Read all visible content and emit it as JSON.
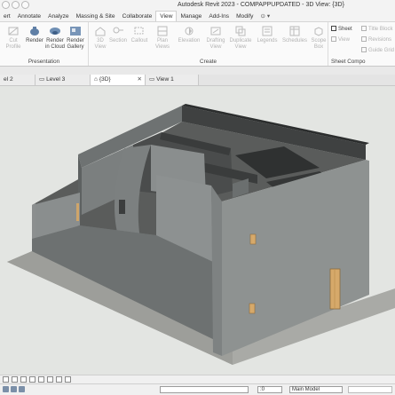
{
  "window": {
    "title": "Autodesk Revit 2023 - COMPAPPUPDATED - 3D View: {3D}"
  },
  "ribbon_tabs": [
    "ert",
    "Annotate",
    "Analyze",
    "Massing & Site",
    "Collaborate",
    "View",
    "Manage",
    "Add-Ins",
    "Modify"
  ],
  "active_tab": "View",
  "ribbon": {
    "cut_profile": "Cut\nProfile",
    "render": "Render",
    "render_cloud": "Render\nin Cloud",
    "render_gallery": "Render\nGallery",
    "view_3d": "3D\nView",
    "section": "Section",
    "callout": "Callout",
    "plan_views": "Plan\nViews",
    "elevation": "Elevation",
    "drafting_view": "Drafting\nView",
    "duplicate_view": "Duplicate\nView",
    "legends": "Legends",
    "schedules": "Schedules",
    "scope_box": "Scope\nBox",
    "sheet": "Sheet",
    "view": "View",
    "title_block": "Title Block",
    "revisions": "Revisions",
    "guide_grid": "Guide Grid",
    "panel_presentation": "Presentation",
    "panel_create": "Create",
    "panel_sheet": "Sheet Compo"
  },
  "view_tabs": [
    {
      "label": "el 2",
      "active": false
    },
    {
      "label": "Level 3",
      "active": false
    },
    {
      "label": "{3D}",
      "active": true
    },
    {
      "label": "View 1",
      "active": false
    }
  ],
  "status": {
    "model": "Main Model",
    "zero": ":0"
  },
  "colors": {
    "wall": "#6f7373",
    "wall_dark": "#3b3d3d",
    "floor": "#5a5c5b",
    "door": "#d6a96a",
    "background": "#e3e5e2"
  }
}
